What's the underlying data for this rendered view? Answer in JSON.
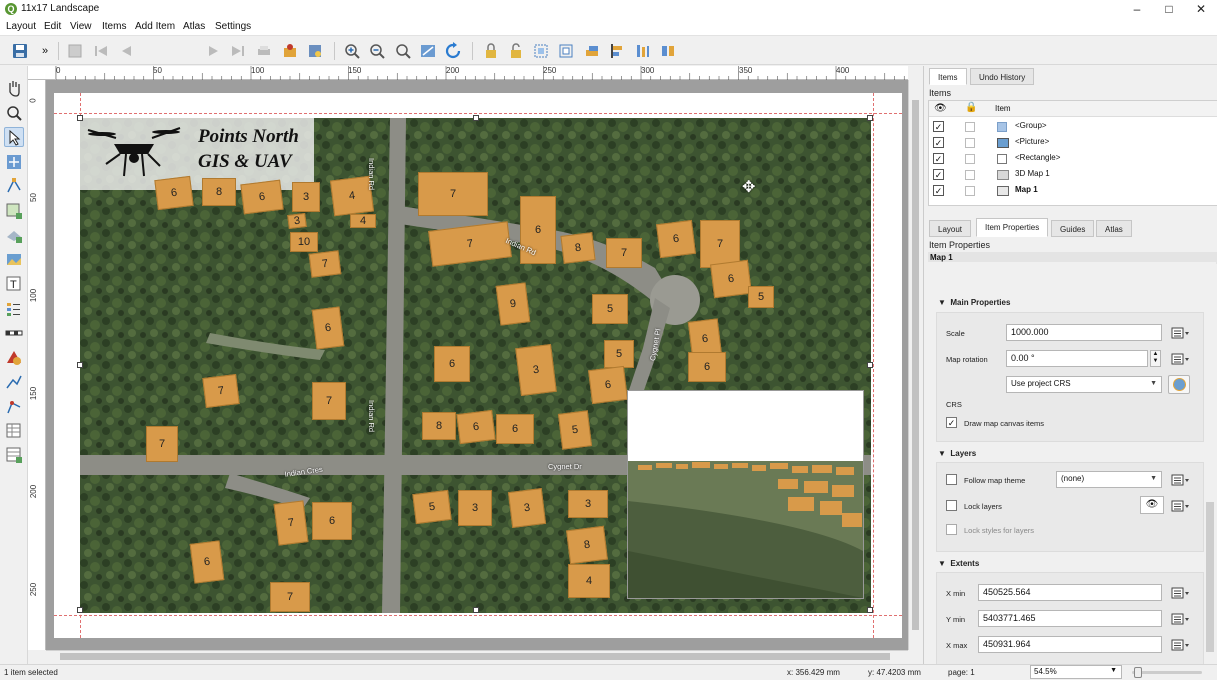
{
  "window": {
    "title": "11x17 Landscape",
    "app_icon": "qgis-icon"
  },
  "menu": [
    "Layout",
    "Edit",
    "View",
    "Items",
    "Add Item",
    "Atlas",
    "Settings"
  ],
  "toolbar": {
    "page_value": "1"
  },
  "ruler": {
    "h_labels": [
      "0",
      "50",
      "100",
      "150",
      "200",
      "250",
      "300",
      "350",
      "400"
    ],
    "v_labels": [
      "0",
      "50",
      "100",
      "150",
      "200",
      "250"
    ]
  },
  "map": {
    "logo_line1": "Points North",
    "logo_line2": "GIS & UAV",
    "street_labels": [
      "Indian Rd",
      "Indian Rd",
      "Indian Rd",
      "Indian Cres",
      "Cygnet Dr",
      "Cygnet Pl"
    ],
    "building_counts": [
      "6",
      "8",
      "6",
      "3",
      "4",
      "4",
      "3",
      "10",
      "7",
      "7",
      "7",
      "6",
      "8",
      "7",
      "6",
      "7",
      "6",
      "5",
      "9",
      "5",
      "6",
      "6",
      "3",
      "5",
      "6",
      "6",
      "6",
      "7",
      "7",
      "8",
      "6",
      "6",
      "5",
      "7",
      "5",
      "3",
      "3",
      "3",
      "8",
      "4",
      "7",
      "6",
      "6",
      "7"
    ]
  },
  "items_panel": {
    "tabs": [
      "Items",
      "Undo History"
    ],
    "title": "Items",
    "column_header": "Item",
    "rows": [
      {
        "label": "<Group>",
        "visible": true,
        "bold": false
      },
      {
        "label": "<Picture>",
        "visible": true,
        "bold": false
      },
      {
        "label": "<Rectangle>",
        "visible": true,
        "bold": false
      },
      {
        "label": "3D Map 1",
        "visible": true,
        "bold": false
      },
      {
        "label": "Map 1",
        "visible": true,
        "bold": true
      }
    ]
  },
  "props_panel": {
    "tabs": [
      "Layout",
      "Item Properties",
      "Guides",
      "Atlas"
    ],
    "title": "Item Properties",
    "item_name": "Map 1",
    "main_section": "Main Properties",
    "scale_label": "Scale",
    "scale_value": "1000.000",
    "rotation_label": "Map rotation",
    "rotation_value": "0.00 °",
    "crs_combo": "Use project CRS",
    "crs_label": "CRS",
    "draw_canvas_items": "Draw map canvas items",
    "layers_section": "Layers",
    "follow_theme": "Follow map theme",
    "theme_value": "(none)",
    "lock_layers": "Lock layers",
    "lock_styles": "Lock styles for layers",
    "extents_section": "Extents",
    "xmin_label": "X min",
    "xmin_value": "450525.564",
    "ymin_label": "Y min",
    "ymin_value": "5403771.465",
    "xmax_label": "X max",
    "xmax_value": "450931.964"
  },
  "status": {
    "selection": "1 item selected",
    "x": "x: 356.429 mm",
    "y": "y: 47.4203 mm",
    "page": "page: 1",
    "zoom": "54.5%"
  },
  "colors": {
    "building": "#d89a4a",
    "road": "#8d8d86",
    "vegetation": "#3b5230",
    "selection": "#cfe0f3"
  }
}
